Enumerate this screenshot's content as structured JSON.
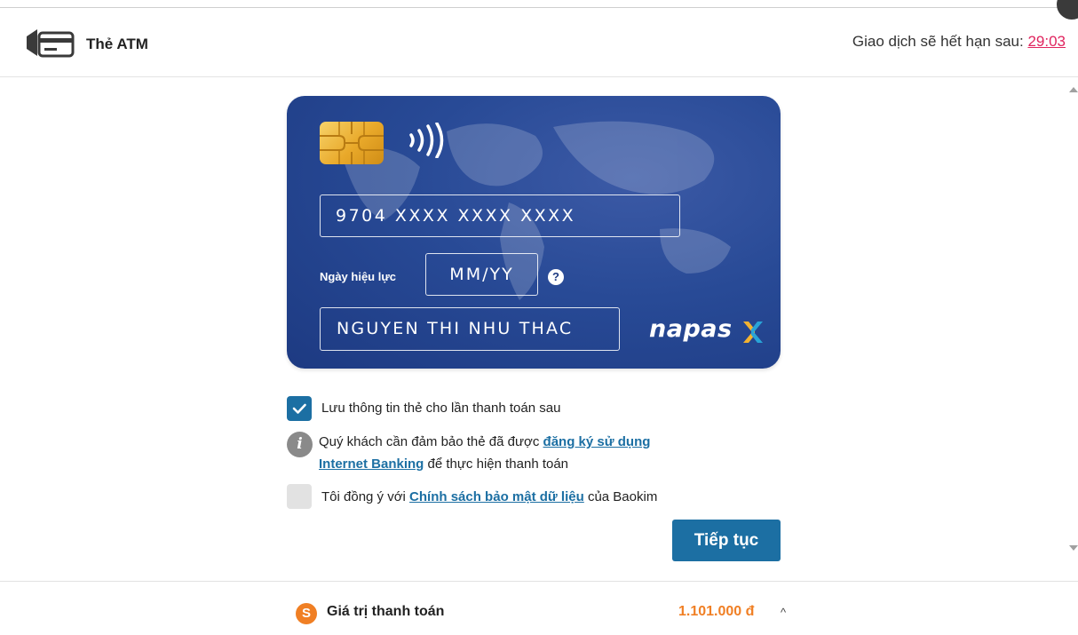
{
  "header": {
    "title": "Thẻ ATM",
    "timer_label": "Giao dịch sẽ hết hạn sau: ",
    "timer_value": "29:03"
  },
  "card": {
    "number_placeholder": "9704 XXXX XXXX XXXX",
    "expiry_label": "Ngày hiệu lực",
    "expiry_placeholder": "MM/YY",
    "help_glyph": "?",
    "holder_name": "NGUYEN THI NHU THAC",
    "brand": "napas"
  },
  "options": {
    "save_card_label": "Lưu thông tin thẻ cho lần thanh toán sau",
    "save_card_checked": true,
    "info_prefix": "Quý khách cần đảm bảo thẻ đã được ",
    "info_link1": "đăng ký sử dụng",
    "info_link2": "Internet Banking",
    "info_suffix": " để thực hiện thanh toán",
    "agree_prefix": "Tôi đồng ý với ",
    "agree_link": "Chính sách bảo mật dữ liệu",
    "agree_suffix": " của Baokim",
    "agree_checked": false
  },
  "actions": {
    "continue_label": "Tiếp tục"
  },
  "footer": {
    "coin_glyph": "S",
    "label": "Giá trị thanh toán",
    "amount": "1.101.000 đ",
    "chevron": "^"
  },
  "colors": {
    "primary": "#1c6fa3",
    "card_dark": "#1d3a82",
    "card_light": "#3c5aa6",
    "timer": "#e0245e",
    "amount": "#f07f24"
  }
}
